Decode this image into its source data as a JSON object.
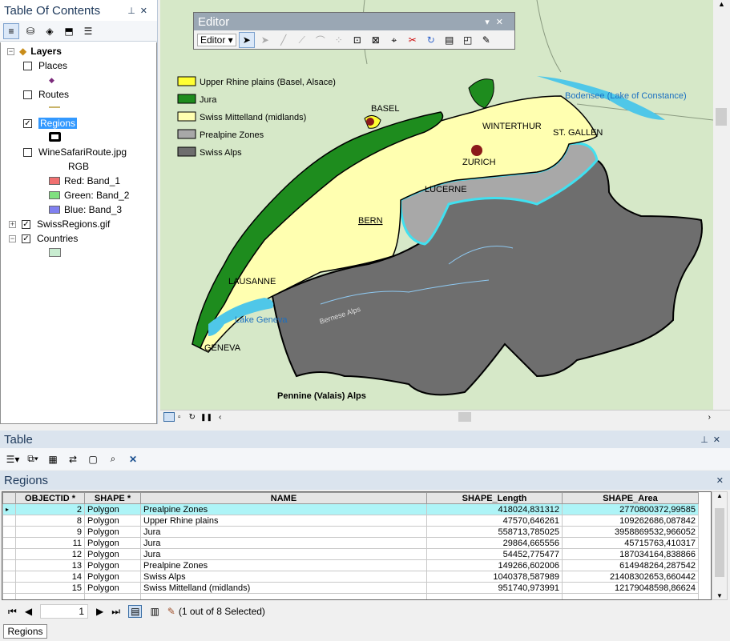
{
  "toc": {
    "title": "Table Of Contents",
    "root": "Layers",
    "layers": [
      {
        "name": "Places",
        "checked": false
      },
      {
        "name": "Routes",
        "checked": false
      },
      {
        "name": "Regions",
        "checked": true
      },
      {
        "name": "WineSafariRoute.jpg",
        "checked": false
      },
      {
        "name": "SwissRegions.gif",
        "checked": true
      },
      {
        "name": "Countries",
        "checked": true
      }
    ],
    "rgb_label": "RGB",
    "bands": [
      {
        "label": "Red:   Band_1",
        "color": "#f07070"
      },
      {
        "label": "Green: Band_2",
        "color": "#80e080"
      },
      {
        "label": "Blue:   Band_3",
        "color": "#8080f0"
      }
    ]
  },
  "editor": {
    "title": "Editor",
    "menu_label": "Editor ▾"
  },
  "map": {
    "legend": [
      {
        "label": "Upper Rhine plains (Basel, Alsace)",
        "color": "#ffff33"
      },
      {
        "label": "Jura",
        "color": "#1e8c1e"
      },
      {
        "label": "Swiss Mittelland (midlands)",
        "color": "#ffffb0"
      },
      {
        "label": "Prealpine Zones",
        "color": "#a8a8a8"
      },
      {
        "label": "Swiss Alps",
        "color": "#6e6e6e"
      }
    ],
    "places": {
      "basel": "BASEL",
      "winterthur": "WINTERTHUR",
      "st_gallen": "ST. GALLEN",
      "zurich": "ZURICH",
      "lucerne": "LUCERNE",
      "bern": "BERN",
      "lausanne": "LAUSANNE",
      "geneva": "GENEVA",
      "lake_constance": "Bodensee (Lake of Constance)",
      "lake_geneva": "Lake Geneva",
      "alps": "Pennine (Valais) Alps",
      "bernese": "Bernese Alps"
    }
  },
  "table": {
    "title": "Table",
    "layer_tab": "Regions",
    "columns": [
      "OBJECTID *",
      "SHAPE *",
      "NAME",
      "SHAPE_Length",
      "SHAPE_Area"
    ],
    "rows": [
      [
        "2",
        "Polygon",
        "Prealpine Zones",
        "418024,831312",
        "2770800372,99585"
      ],
      [
        "8",
        "Polygon",
        "Upper Rhine plains",
        "47570,646261",
        "109262686,087842"
      ],
      [
        "9",
        "Polygon",
        "Jura",
        "558713,785025",
        "3958869532,966052"
      ],
      [
        "11",
        "Polygon",
        "Jura",
        "29864,665556",
        "45715763,410317"
      ],
      [
        "12",
        "Polygon",
        "Jura",
        "54452,775477",
        "187034164,838866"
      ],
      [
        "13",
        "Polygon",
        "Prealpine Zones",
        "149266,602006",
        "614948264,287542"
      ],
      [
        "14",
        "Polygon",
        "Swiss Alps",
        "1040378,587989",
        "21408302653,660442"
      ],
      [
        "15",
        "Polygon",
        "Swiss Mittelland (midlands)",
        "951740,973991",
        "12179048598,86624"
      ]
    ],
    "selected_row": 0,
    "page": "1",
    "selection_status": "(1 out of 8 Selected)",
    "bottom_tab": "Regions"
  }
}
